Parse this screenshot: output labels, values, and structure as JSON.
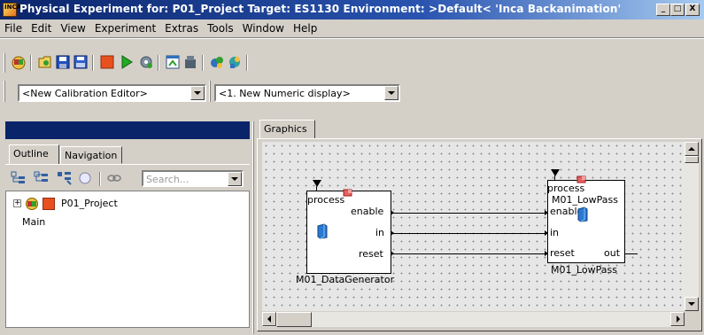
{
  "window": {
    "title": "Physical Experiment for: P01_Project  Target: ES1130  Environment: >Default<  'Inca Backanimation'",
    "app_icon_text": "INCA",
    "minimize": "_",
    "maximize": "□",
    "close": "X"
  },
  "menu": {
    "items": [
      "File",
      "Edit",
      "View",
      "Experiment",
      "Extras",
      "Tools",
      "Window",
      "Help"
    ]
  },
  "toolbar": {
    "icons": [
      "experiment-icon",
      "open-icon",
      "save-icon",
      "save-all-icon",
      "stop-icon",
      "run-icon",
      "settings-icon",
      "window-icon",
      "hardware-icon",
      "add-icon",
      "extras-icon"
    ]
  },
  "combos": {
    "editor": "<New Calibration Editor>",
    "display": "<1. New Numeric display>"
  },
  "left_panel": {
    "tabs": [
      "Outline",
      "Navigation"
    ],
    "search_placeholder": "Search...",
    "tree": {
      "expander": "+",
      "root_label": "P01_Project",
      "selected_label": "Main"
    }
  },
  "graphics": {
    "tab": "Graphics",
    "blocks": [
      {
        "id": "data-generator",
        "name": "M01_DataGenerator",
        "process_label": "process",
        "ports": [
          "enable",
          "in",
          "reset"
        ]
      },
      {
        "id": "lowpass",
        "name": "M01_LowPass",
        "process_label": "process",
        "inner_name": "M01_LowPass",
        "ports_in": [
          "enable",
          "in",
          "reset"
        ],
        "port_out": "out"
      }
    ]
  },
  "colors": {
    "title_bar": "#0a246a",
    "panel_bg": "#d4d0c8",
    "canvas_bg": "#e6e6e6",
    "stop_icon": "#e8501e",
    "run_icon": "#22aa22"
  }
}
